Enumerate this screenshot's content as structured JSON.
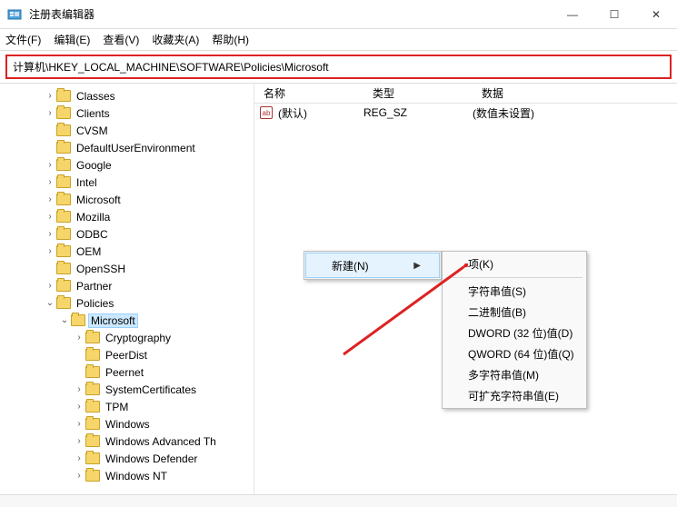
{
  "window": {
    "title": "注册表编辑器",
    "min": "—",
    "max": "☐",
    "close": "✕"
  },
  "menubar": [
    "文件(F)",
    "编辑(E)",
    "查看(V)",
    "收藏夹(A)",
    "帮助(H)"
  ],
  "address": "计算机\\HKEY_LOCAL_MACHINE\\SOFTWARE\\Policies\\Microsoft",
  "tree": [
    {
      "d": 3,
      "t": ">",
      "l": "Classes"
    },
    {
      "d": 3,
      "t": ">",
      "l": "Clients"
    },
    {
      "d": 3,
      "t": "",
      "l": "CVSM"
    },
    {
      "d": 3,
      "t": "",
      "l": "DefaultUserEnvironment"
    },
    {
      "d": 3,
      "t": ">",
      "l": "Google"
    },
    {
      "d": 3,
      "t": ">",
      "l": "Intel"
    },
    {
      "d": 3,
      "t": ">",
      "l": "Microsoft"
    },
    {
      "d": 3,
      "t": ">",
      "l": "Mozilla"
    },
    {
      "d": 3,
      "t": ">",
      "l": "ODBC"
    },
    {
      "d": 3,
      "t": ">",
      "l": "OEM"
    },
    {
      "d": 3,
      "t": "",
      "l": "OpenSSH"
    },
    {
      "d": 3,
      "t": ">",
      "l": "Partner"
    },
    {
      "d": 3,
      "t": "v",
      "l": "Policies"
    },
    {
      "d": 4,
      "t": "v",
      "l": "Microsoft",
      "sel": true
    },
    {
      "d": 5,
      "t": ">",
      "l": "Cryptography"
    },
    {
      "d": 5,
      "t": "",
      "l": "PeerDist"
    },
    {
      "d": 5,
      "t": "",
      "l": "Peernet"
    },
    {
      "d": 5,
      "t": ">",
      "l": "SystemCertificates"
    },
    {
      "d": 5,
      "t": ">",
      "l": "TPM"
    },
    {
      "d": 5,
      "t": ">",
      "l": "Windows"
    },
    {
      "d": 5,
      "t": ">",
      "l": "Windows Advanced Th"
    },
    {
      "d": 5,
      "t": ">",
      "l": "Windows Defender"
    },
    {
      "d": 5,
      "t": ">",
      "l": "Windows NT"
    }
  ],
  "list": {
    "headers": {
      "name": "名称",
      "type": "类型",
      "data": "数据"
    },
    "rows": [
      {
        "icon": "ab",
        "name": "(默认)",
        "type": "REG_SZ",
        "data": "(数值未设置)"
      }
    ]
  },
  "context1": {
    "label": "新建(N)"
  },
  "context2": [
    {
      "l": "项(K)"
    },
    {
      "sep": true
    },
    {
      "l": "字符串值(S)"
    },
    {
      "l": "二进制值(B)"
    },
    {
      "l": "DWORD (32 位)值(D)"
    },
    {
      "l": "QWORD (64 位)值(Q)"
    },
    {
      "l": "多字符串值(M)"
    },
    {
      "l": "可扩充字符串值(E)"
    }
  ]
}
